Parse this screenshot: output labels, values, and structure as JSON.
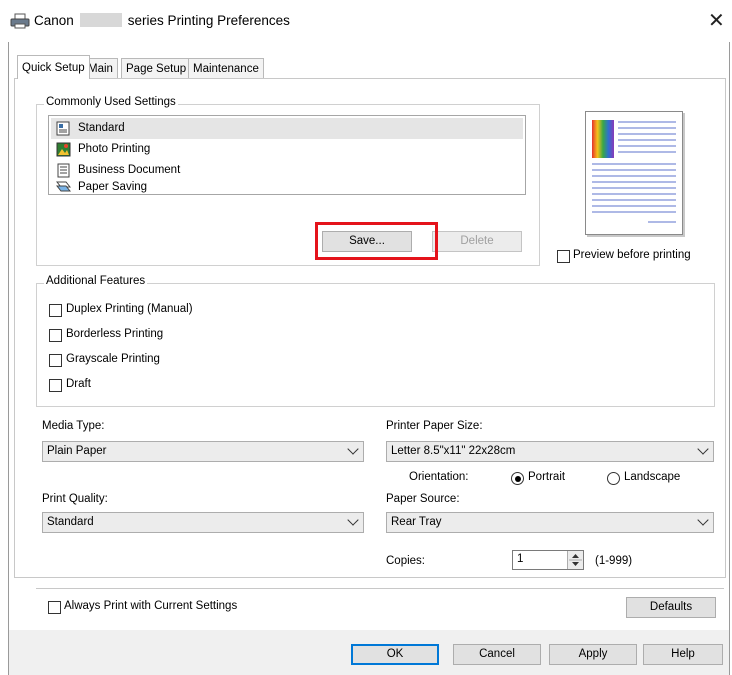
{
  "window": {
    "title_prefix": "Canon",
    "title_suffix": "series Printing Preferences",
    "close_glyph": "✕"
  },
  "tabs": [
    {
      "label": "Quick Setup",
      "active": true
    },
    {
      "label": "Main",
      "active": false
    },
    {
      "label": "Page Setup",
      "active": false
    },
    {
      "label": "Maintenance",
      "active": false
    }
  ],
  "common": {
    "group_label": "Commonly Used Settings",
    "items": [
      {
        "label": "Standard",
        "icon": "standard-icon",
        "selected": true
      },
      {
        "label": "Photo Printing",
        "icon": "photo-printing-icon",
        "selected": false
      },
      {
        "label": "Business Document",
        "icon": "business-document-icon",
        "selected": false
      },
      {
        "label": "Paper Saving",
        "icon": "paper-saving-icon",
        "selected": false
      }
    ],
    "save_label": "Save...",
    "delete_label": "Delete"
  },
  "preview": {
    "checkbox_label": "Preview before printing",
    "checked": false
  },
  "features": {
    "group_label": "Additional Features",
    "items": [
      {
        "label": "Duplex Printing (Manual)",
        "checked": false
      },
      {
        "label": "Borderless Printing",
        "checked": false
      },
      {
        "label": "Grayscale Printing",
        "checked": false
      },
      {
        "label": "Draft",
        "checked": false
      }
    ]
  },
  "media_type": {
    "label": "Media Type:",
    "value": "Plain Paper"
  },
  "paper_size": {
    "label": "Printer Paper Size:",
    "value": "Letter 8.5\"x11\" 22x28cm"
  },
  "orientation": {
    "label": "Orientation:",
    "portrait": "Portrait",
    "landscape": "Landscape",
    "selected": "Portrait"
  },
  "print_quality": {
    "label": "Print Quality:",
    "value": "Standard"
  },
  "paper_source": {
    "label": "Paper Source:",
    "value": "Rear Tray"
  },
  "copies": {
    "label": "Copies:",
    "value": "1",
    "range": "(1-999)"
  },
  "always_print": {
    "label": "Always Print with Current Settings",
    "checked": false
  },
  "defaults_label": "Defaults",
  "buttons": {
    "ok": "OK",
    "cancel": "Cancel",
    "apply": "Apply",
    "help": "Help"
  },
  "colors": {
    "highlight": "#e4131b",
    "accent": "#0078d7",
    "selection": "#e5e5e5"
  }
}
